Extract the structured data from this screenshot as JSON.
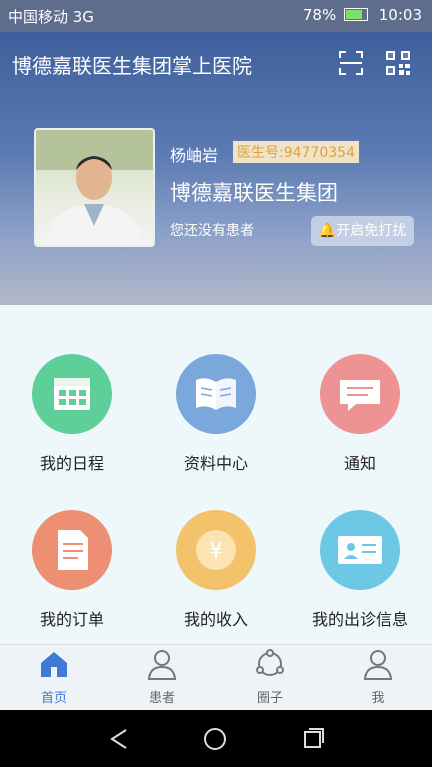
{
  "status_bar": {
    "carrier": "中国移动 3G",
    "battery": "78%",
    "time": "10:03"
  },
  "header": {
    "title": "博德嘉联医生集团掌上医院"
  },
  "profile": {
    "name": "杨岫岩",
    "doctor_id": "医生号:94770354",
    "organization": "博德嘉联医生集团",
    "patient_status": "您还没有患者",
    "dnd_button": "开启免打扰"
  },
  "menu": [
    {
      "label": "我的日程",
      "color": "#5fcf9a",
      "icon": "calendar-icon"
    },
    {
      "label": "资料中心",
      "color": "#7aa7dc",
      "icon": "book-icon"
    },
    {
      "label": "通知",
      "color": "#ee9394",
      "icon": "message-icon"
    },
    {
      "label": "我的订单",
      "color": "#ec8f72",
      "icon": "document-icon"
    },
    {
      "label": "我的收入",
      "color": "#f3c36b",
      "icon": "yen-coin-icon"
    },
    {
      "label": "我的出诊信息",
      "color": "#6cc8e4",
      "icon": "id-card-icon"
    }
  ],
  "tabs": [
    {
      "label": "首页",
      "icon": "home-icon",
      "active": true
    },
    {
      "label": "患者",
      "icon": "patient-icon"
    },
    {
      "label": "圈子",
      "icon": "circle-icon"
    },
    {
      "label": "我",
      "icon": "person-icon"
    }
  ],
  "accent_color": "#3d7bd6"
}
